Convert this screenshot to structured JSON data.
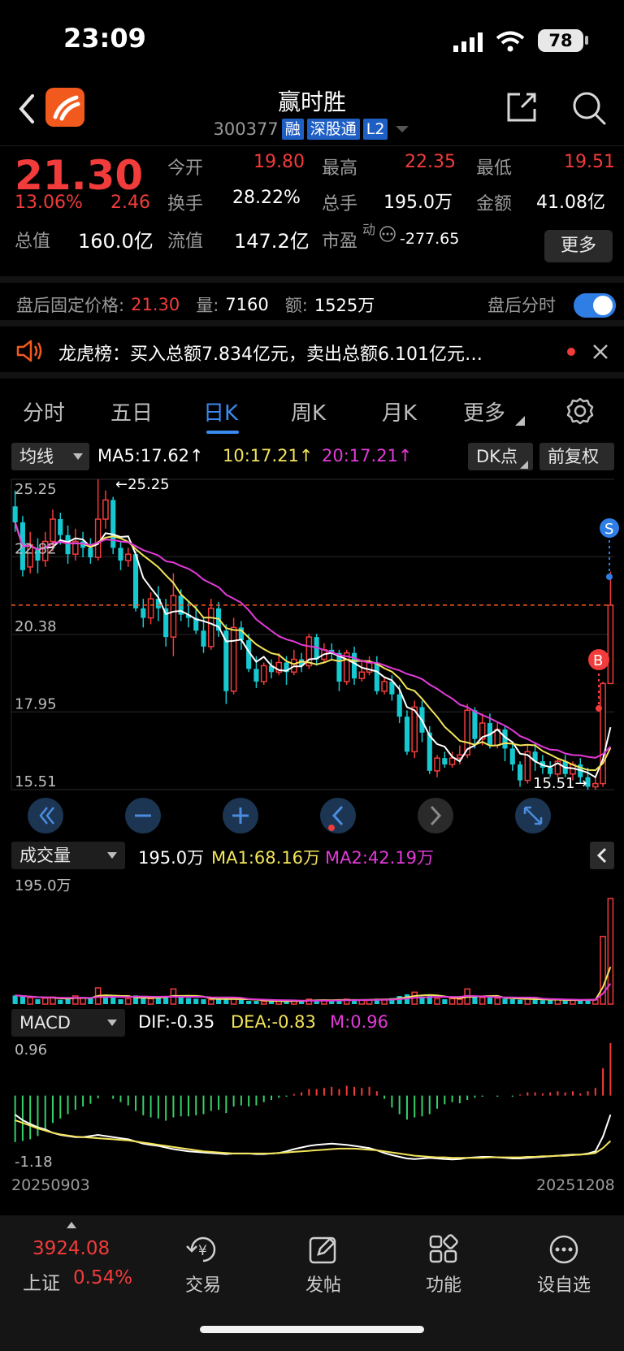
{
  "status": {
    "time": "23:09",
    "battery": "78"
  },
  "header": {
    "name": "赢时胜",
    "code": "300377",
    "tags": [
      "融",
      "深股通",
      "L2"
    ]
  },
  "quote": {
    "price": "21.30",
    "change_pct": "13.06%",
    "change": "2.46",
    "open_label": "今开",
    "open": "19.80",
    "high_label": "最高",
    "high": "22.35",
    "low_label": "最低",
    "low": "19.51",
    "turnover_label": "换手",
    "turnover": "28.22%",
    "volume_label": "总手",
    "volume": "195.0万",
    "amount_label": "金额",
    "amount": "41.08亿",
    "mcap_label": "总值",
    "mcap": "160.0亿",
    "float_label": "流值",
    "float": "147.2亿",
    "pe_label": "市盈",
    "pe_sup": "动",
    "pe": "-277.65",
    "more": "更多"
  },
  "after_hours": {
    "label": "盘后固定价格:",
    "price": "21.30",
    "vol_label": "量:",
    "vol": "7160",
    "amt_label": "额:",
    "amt": "1525万",
    "toggle_label": "盘后分时"
  },
  "news": {
    "text": "龙虎榜：买入总额7.834亿元，卖出总额6.101亿元…"
  },
  "tabs": [
    "分时",
    "五日",
    "日K",
    "周K",
    "月K",
    "更多"
  ],
  "toolbar": {
    "ma_selector": "均线",
    "ma5": "MA5:17.62",
    "ma10": "10:17.21",
    "ma20": "20:17.21",
    "dk": "DK点",
    "adjust": "前复权"
  },
  "kline": {
    "y_labels": [
      "25.25",
      "22.82",
      "20.38",
      "17.95",
      "15.51"
    ],
    "max_label": "←25.25",
    "min_label": "15.51→",
    "marker_s": "S",
    "marker_b": "B"
  },
  "volume": {
    "selector": "成交量",
    "value": "195.0万",
    "ma1": "MA1:68.16万",
    "ma2": "MA2:42.19万",
    "y_max": "195.0万"
  },
  "macd": {
    "selector": "MACD",
    "dif": "DIF:-0.35",
    "dea": "DEA:-0.83",
    "m": "M:0.96",
    "y_max": "0.96",
    "y_min": "-1.18"
  },
  "dates": {
    "start": "20250903",
    "end": "20251208"
  },
  "bottom": {
    "index_value": "3924.08",
    "index_name": "上证",
    "index_change": "0.54%",
    "nav": [
      "交易",
      "发帖",
      "功能",
      "设自选"
    ]
  },
  "colors": {
    "up": "#f23b3b",
    "down": "#16c8d0",
    "ma5": "#ffffff",
    "ma10": "#f3e45a",
    "ma20": "#e23ad9",
    "accent": "#2f7ee6"
  },
  "chart_data": {
    "type": "candlestick",
    "title": "",
    "ylim": [
      15.51,
      25.25
    ],
    "candles": [
      [
        24.4,
        23.9,
        24.9,
        23.6
      ],
      [
        23.9,
        22.4,
        24.1,
        22.2
      ],
      [
        22.5,
        23.2,
        23.6,
        22.3
      ],
      [
        23.1,
        22.7,
        23.4,
        22.3
      ],
      [
        22.7,
        23.3,
        23.6,
        22.5
      ],
      [
        23.3,
        24.0,
        24.3,
        23.0
      ],
      [
        24.0,
        23.5,
        24.2,
        23.2
      ],
      [
        23.5,
        22.9,
        23.8,
        22.6
      ],
      [
        22.9,
        23.3,
        23.7,
        22.7
      ],
      [
        23.3,
        23.1,
        23.6,
        22.8
      ],
      [
        23.1,
        22.8,
        23.4,
        22.6
      ],
      [
        22.8,
        24.0,
        25.25,
        22.7
      ],
      [
        24.0,
        24.6,
        24.9,
        23.7
      ],
      [
        24.6,
        23.1,
        24.7,
        22.9
      ],
      [
        23.1,
        22.7,
        23.3,
        22.4
      ],
      [
        22.7,
        22.9,
        23.1,
        22.5
      ],
      [
        22.9,
        21.2,
        23.0,
        21.1
      ],
      [
        21.2,
        20.9,
        21.5,
        20.6
      ],
      [
        20.9,
        21.5,
        21.7,
        20.7
      ],
      [
        21.5,
        21.2,
        21.9,
        20.8
      ],
      [
        21.2,
        20.3,
        21.5,
        20.0
      ],
      [
        20.3,
        21.6,
        22.3,
        19.7
      ],
      [
        21.6,
        21.0,
        21.8,
        20.8
      ],
      [
        21.0,
        20.9,
        21.4,
        20.6
      ],
      [
        20.9,
        20.5,
        21.3,
        20.4
      ],
      [
        20.5,
        20.0,
        20.9,
        19.8
      ],
      [
        20.0,
        21.2,
        21.5,
        19.9
      ],
      [
        21.2,
        20.5,
        21.4,
        20.3
      ],
      [
        20.5,
        18.6,
        20.7,
        18.2
      ],
      [
        18.6,
        20.6,
        20.9,
        18.5
      ],
      [
        20.6,
        20.2,
        20.8,
        19.9
      ],
      [
        20.2,
        19.3,
        20.4,
        19.2
      ],
      [
        19.3,
        18.9,
        19.7,
        18.7
      ],
      [
        18.9,
        19.4,
        19.5,
        18.8
      ],
      [
        19.4,
        19.2,
        19.6,
        19.0
      ],
      [
        19.2,
        19.5,
        19.8,
        19.1
      ],
      [
        19.5,
        19.2,
        19.7,
        18.8
      ],
      [
        19.2,
        19.6,
        19.9,
        19.1
      ],
      [
        19.6,
        19.4,
        19.8,
        19.2
      ],
      [
        19.4,
        20.3,
        20.4,
        19.3
      ],
      [
        20.3,
        19.6,
        20.4,
        19.4
      ],
      [
        19.6,
        19.9,
        20.1,
        19.5
      ],
      [
        19.9,
        19.8,
        20.1,
        19.6
      ],
      [
        19.8,
        18.9,
        19.9,
        18.6
      ],
      [
        18.9,
        19.8,
        19.9,
        18.8
      ],
      [
        19.8,
        19.0,
        20.0,
        18.8
      ],
      [
        19.0,
        19.2,
        19.6,
        18.9
      ],
      [
        19.2,
        19.5,
        19.7,
        19.1
      ],
      [
        19.5,
        18.6,
        19.7,
        18.5
      ],
      [
        18.6,
        18.9,
        19.0,
        18.5
      ],
      [
        18.9,
        18.5,
        19.1,
        18.3
      ],
      [
        18.5,
        17.8,
        18.8,
        17.6
      ],
      [
        17.8,
        16.7,
        18.0,
        16.6
      ],
      [
        16.7,
        18.1,
        18.3,
        16.5
      ],
      [
        18.1,
        17.3,
        18.3,
        17.0
      ],
      [
        17.3,
        16.1,
        17.5,
        16.0
      ],
      [
        16.1,
        16.5,
        16.6,
        15.9
      ],
      [
        16.5,
        16.3,
        16.7,
        16.2
      ],
      [
        16.3,
        16.5,
        16.7,
        16.2
      ],
      [
        16.5,
        16.6,
        16.9,
        16.3
      ],
      [
        16.6,
        18.0,
        18.2,
        16.5
      ],
      [
        18.0,
        17.1,
        18.1,
        16.8
      ],
      [
        17.1,
        17.6,
        17.9,
        16.9
      ],
      [
        17.6,
        16.9,
        17.9,
        16.8
      ],
      [
        16.9,
        17.4,
        17.6,
        16.8
      ],
      [
        17.4,
        16.8,
        17.5,
        16.4
      ],
      [
        16.8,
        16.3,
        17.0,
        16.1
      ],
      [
        16.3,
        15.8,
        16.4,
        15.6
      ],
      [
        15.8,
        16.7,
        16.9,
        15.7
      ],
      [
        16.7,
        16.4,
        17.0,
        16.1
      ],
      [
        16.4,
        16.2,
        16.6,
        16.0
      ],
      [
        16.2,
        16.0,
        16.4,
        15.9
      ],
      [
        16.0,
        16.4,
        16.5,
        15.9
      ],
      [
        16.4,
        16.0,
        16.6,
        15.9
      ],
      [
        16.0,
        16.3,
        16.4,
        15.8
      ],
      [
        16.3,
        15.9,
        16.5,
        15.7
      ],
      [
        15.9,
        15.6,
        16.2,
        15.51
      ],
      [
        15.6,
        15.7,
        15.9,
        15.51
      ],
      [
        15.7,
        18.84,
        18.9,
        15.6
      ],
      [
        18.84,
        21.3,
        22.35,
        19.51
      ]
    ],
    "volumes": [
      [
        16,
        "d"
      ],
      [
        14,
        "d"
      ],
      [
        12,
        "u"
      ],
      [
        9,
        "d"
      ],
      [
        11,
        "u"
      ],
      [
        13,
        "u"
      ],
      [
        8,
        "d"
      ],
      [
        9,
        "d"
      ],
      [
        15,
        "u"
      ],
      [
        12,
        "u"
      ],
      [
        11,
        "d"
      ],
      [
        30,
        "u"
      ],
      [
        14,
        "d"
      ],
      [
        12,
        "d"
      ],
      [
        9,
        "d"
      ],
      [
        10,
        "u"
      ],
      [
        16,
        "d"
      ],
      [
        12,
        "d"
      ],
      [
        10,
        "u"
      ],
      [
        11,
        "d"
      ],
      [
        15,
        "d"
      ],
      [
        28,
        "u"
      ],
      [
        12,
        "d"
      ],
      [
        11,
        "d"
      ],
      [
        10,
        "d"
      ],
      [
        9,
        "d"
      ],
      [
        8,
        "u"
      ],
      [
        9,
        "d"
      ],
      [
        11,
        "d"
      ],
      [
        10,
        "u"
      ],
      [
        8,
        "d"
      ],
      [
        6,
        "d"
      ],
      [
        6,
        "d"
      ],
      [
        5,
        "u"
      ],
      [
        5,
        "d"
      ],
      [
        6,
        "u"
      ],
      [
        5,
        "d"
      ],
      [
        7,
        "u"
      ],
      [
        6,
        "d"
      ],
      [
        9,
        "u"
      ],
      [
        8,
        "d"
      ],
      [
        7,
        "u"
      ],
      [
        6,
        "d"
      ],
      [
        8,
        "d"
      ],
      [
        9,
        "u"
      ],
      [
        8,
        "d"
      ],
      [
        7,
        "u"
      ],
      [
        8,
        "u"
      ],
      [
        10,
        "d"
      ],
      [
        9,
        "u"
      ],
      [
        11,
        "d"
      ],
      [
        15,
        "d"
      ],
      [
        18,
        "d"
      ],
      [
        22,
        "u"
      ],
      [
        14,
        "d"
      ],
      [
        16,
        "d"
      ],
      [
        10,
        "u"
      ],
      [
        9,
        "d"
      ],
      [
        10,
        "u"
      ],
      [
        9,
        "u"
      ],
      [
        28,
        "u"
      ],
      [
        13,
        "d"
      ],
      [
        12,
        "u"
      ],
      [
        12,
        "d"
      ],
      [
        11,
        "u"
      ],
      [
        10,
        "d"
      ],
      [
        9,
        "d"
      ],
      [
        8,
        "d"
      ],
      [
        10,
        "u"
      ],
      [
        9,
        "d"
      ],
      [
        7,
        "d"
      ],
      [
        7,
        "d"
      ],
      [
        8,
        "u"
      ],
      [
        7,
        "d"
      ],
      [
        8,
        "u"
      ],
      [
        7,
        "d"
      ],
      [
        9,
        "d"
      ],
      [
        8,
        "u"
      ],
      [
        125,
        "u"
      ],
      [
        195,
        "u"
      ]
    ],
    "macd_bars": [
      -0.85,
      -0.83,
      -0.8,
      -0.74,
      -0.62,
      -0.5,
      -0.42,
      -0.34,
      -0.26,
      -0.2,
      -0.15,
      -0.05,
      0,
      -0.06,
      -0.12,
      -0.18,
      -0.28,
      -0.36,
      -0.4,
      -0.42,
      -0.46,
      -0.4,
      -0.38,
      -0.38,
      -0.36,
      -0.34,
      -0.28,
      -0.26,
      -0.32,
      -0.2,
      -0.18,
      -0.2,
      -0.18,
      -0.12,
      -0.08,
      -0.04,
      -0.02,
      0.03,
      0.06,
      0.12,
      0.12,
      0.14,
      0.16,
      0.12,
      0.18,
      0.16,
      0.14,
      0.16,
      0.08,
      -0.06,
      -0.22,
      -0.34,
      -0.44,
      -0.4,
      -0.38,
      -0.34,
      -0.24,
      -0.16,
      -0.12,
      -0.14,
      -0.08,
      -0.04,
      -0.02,
      0,
      -0.02,
      0,
      -0.02,
      0.02,
      0.06,
      0.06,
      0.04,
      0.06,
      0.08,
      0.06,
      0.08,
      0.04,
      0.08,
      0.14,
      0.5,
      0.96
    ],
    "dif": [
      -0.35,
      -0.45,
      -0.52,
      -0.58,
      -0.62,
      -0.68,
      -0.72,
      -0.74,
      -0.76,
      -0.76,
      -0.74,
      -0.72,
      -0.74,
      -0.76,
      -0.78,
      -0.8,
      -0.84,
      -0.88,
      -0.9,
      -0.92,
      -0.95,
      -0.98,
      -1.0,
      -1.02,
      -1.03,
      -1.04,
      -1.05,
      -1.06,
      -1.07,
      -1.06,
      -1.06,
      -1.06,
      -1.07,
      -1.07,
      -1.06,
      -1.05,
      -1.02,
      -0.98,
      -0.95,
      -0.92,
      -0.9,
      -0.89,
      -0.88,
      -0.89,
      -0.9,
      -0.92,
      -0.94,
      -0.96,
      -1.0,
      -1.05,
      -1.09,
      -1.12,
      -1.15,
      -1.16,
      -1.15,
      -1.14,
      -1.15,
      -1.16,
      -1.17,
      -1.16,
      -1.14,
      -1.13,
      -1.12,
      -1.12,
      -1.13,
      -1.14,
      -1.15,
      -1.15,
      -1.14,
      -1.13,
      -1.12,
      -1.11,
      -1.1,
      -1.09,
      -1.08,
      -1.08,
      -1.06,
      -1.02,
      -0.75,
      -0.35
    ],
    "dea": [
      -0.45,
      -0.5,
      -0.55,
      -0.6,
      -0.64,
      -0.68,
      -0.71,
      -0.73,
      -0.75,
      -0.76,
      -0.77,
      -0.78,
      -0.79,
      -0.8,
      -0.81,
      -0.82,
      -0.84,
      -0.86,
      -0.88,
      -0.9,
      -0.92,
      -0.94,
      -0.96,
      -0.98,
      -1.0,
      -1.02,
      -1.03,
      -1.04,
      -1.05,
      -1.06,
      -1.06,
      -1.06,
      -1.06,
      -1.06,
      -1.06,
      -1.05,
      -1.04,
      -1.03,
      -1.02,
      -1.01,
      -1.0,
      -0.99,
      -0.98,
      -0.97,
      -0.97,
      -0.97,
      -0.98,
      -0.99,
      -1.0,
      -1.02,
      -1.04,
      -1.06,
      -1.08,
      -1.1,
      -1.11,
      -1.12,
      -1.13,
      -1.13,
      -1.14,
      -1.14,
      -1.14,
      -1.14,
      -1.14,
      -1.13,
      -1.13,
      -1.13,
      -1.13,
      -1.13,
      -1.12,
      -1.12,
      -1.11,
      -1.11,
      -1.1,
      -1.1,
      -1.09,
      -1.08,
      -1.07,
      -1.05,
      -0.96,
      -0.83
    ],
    "macd_ylim": [
      -1.18,
      0.96
    ],
    "date_range": [
      "20250903",
      "20251208"
    ]
  }
}
